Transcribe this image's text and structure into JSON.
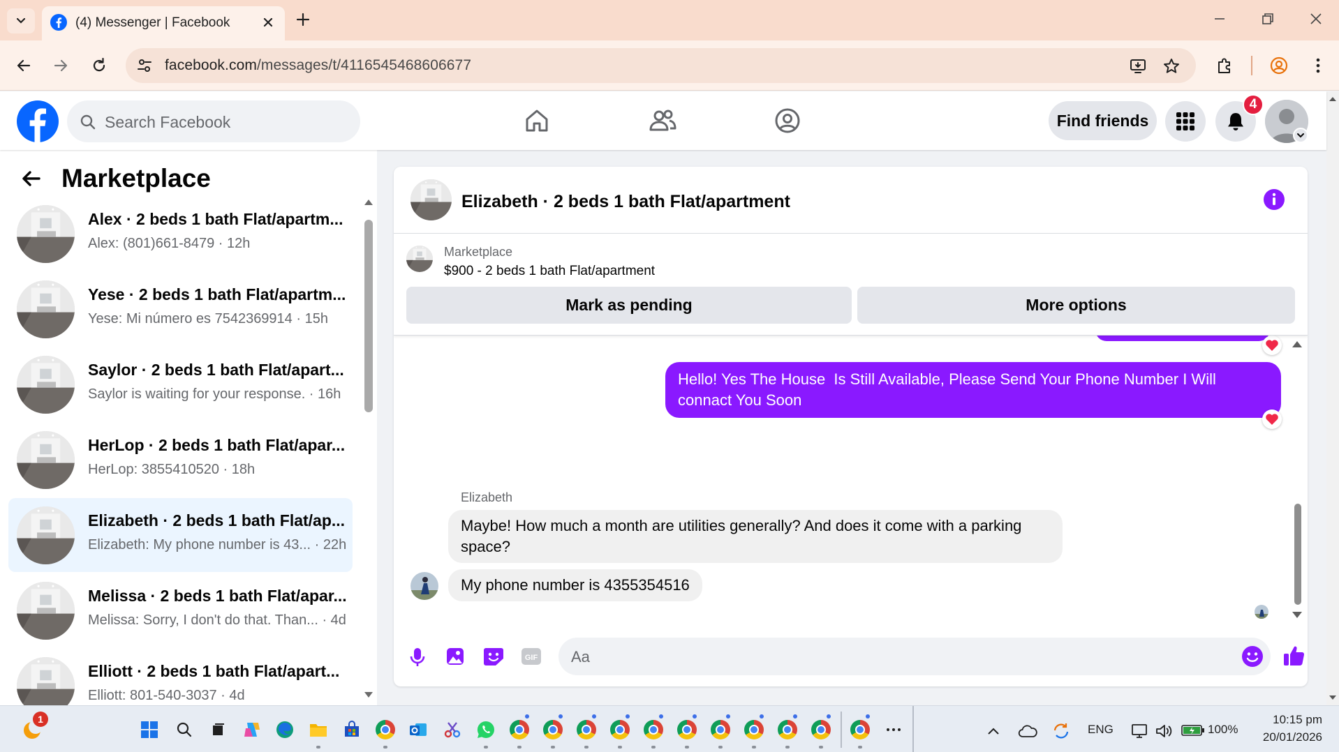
{
  "browser": {
    "tab_title": "(4) Messenger | Facebook",
    "url_host": "facebook.com",
    "url_path": "/messages/t/4116545468606677"
  },
  "header": {
    "search_placeholder": "Search Facebook",
    "find_friends": "Find friends",
    "notification_count": "4"
  },
  "sidebar": {
    "title": "Marketplace",
    "conversations": [
      {
        "name": "Alex · 2 beds 1 bath Flat/apartm...",
        "preview": "Alex: (801)661-8479 · 12h",
        "active": false
      },
      {
        "name": "Yese · 2 beds 1 bath Flat/apartm...",
        "preview": "Yese: Mi número es 7542369914 · 15h",
        "active": false
      },
      {
        "name": "Saylor · 2 beds 1 bath Flat/apart...",
        "preview": "Saylor is waiting for your response. · 16h",
        "active": false
      },
      {
        "name": "HerLop · 2 beds 1 bath Flat/apar...",
        "preview": "HerLop: 3855410520 · 18h",
        "active": false
      },
      {
        "name": "Elizabeth · 2 beds 1 bath Flat/ap...",
        "preview": "Elizabeth: My phone number is 43... · 22h",
        "active": true
      },
      {
        "name": "Melissa · 2 beds 1 bath Flat/apar...",
        "preview": "Melissa: Sorry, I don't do that. Than... · 4d",
        "active": false
      },
      {
        "name": "Elliott · 2 beds 1 bath Flat/apart...",
        "preview": "Elliott: 801-540-3037 · 4d",
        "active": false
      }
    ]
  },
  "chat": {
    "title": "Elizabeth · 2 beds 1 bath Flat/apartment",
    "listing_source": "Marketplace",
    "listing_item": "$900 - 2 beds 1 bath Flat/apartment",
    "mark_pending": "Mark as pending",
    "more_options": "More options",
    "outgoing_message": "Hello! Yes The House  Is Still Available, Please Send Your Phone Number I Will connact You Soon",
    "sender_name": "Elizabeth",
    "incoming_1": "Maybe! How much a month are utilities generally? And does it come with a parking space?",
    "incoming_2": "My phone number is 4355354516",
    "input_placeholder": "Aa"
  },
  "taskbar": {
    "weather_badge": "1",
    "language": "ENG",
    "battery": "100%",
    "time": "10:15 pm",
    "date": "20/01/2026"
  },
  "colors": {
    "facebook_blue": "#0866ff",
    "messenger_purple": "#8a19ff",
    "notification_red": "#e41e3f",
    "active_conversation": "#ebf5ff"
  }
}
